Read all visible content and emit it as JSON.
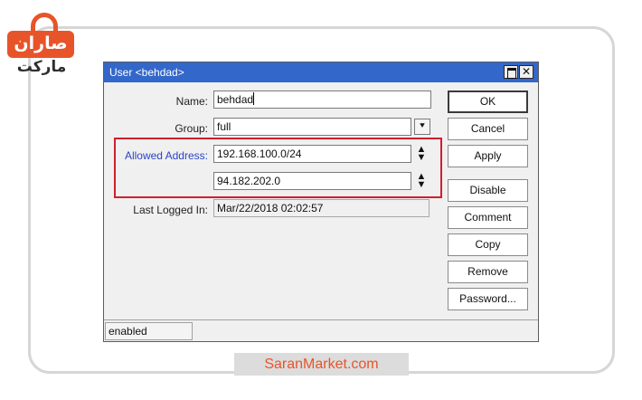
{
  "logo": {
    "line1": "صاران",
    "line2": "مارکت"
  },
  "window": {
    "title": "User <behdad>",
    "close_glyph": "✕"
  },
  "form": {
    "name_label": "Name:",
    "name_value": "behdad",
    "group_label": "Group:",
    "group_value": "full",
    "group_dropdown_glyph": "⯆",
    "allowed_label": "Allowed Address:",
    "allowed_values": [
      "192.168.100.0/24",
      "94.182.202.0"
    ],
    "spin_glyph_up": "▲",
    "spin_glyph_down": "▼",
    "last_logged_label": "Last Logged In:",
    "last_logged_value": "Mar/22/2018 02:02:57"
  },
  "buttons": [
    "OK",
    "Cancel",
    "Apply",
    "Disable",
    "Comment",
    "Copy",
    "Remove",
    "Password..."
  ],
  "status": {
    "text": "enabled"
  },
  "caption": "SaranMarket.com",
  "colors": {
    "titlebar": "#3367c9",
    "highlight_box": "#d01f2e",
    "brand": "#e8542a"
  }
}
